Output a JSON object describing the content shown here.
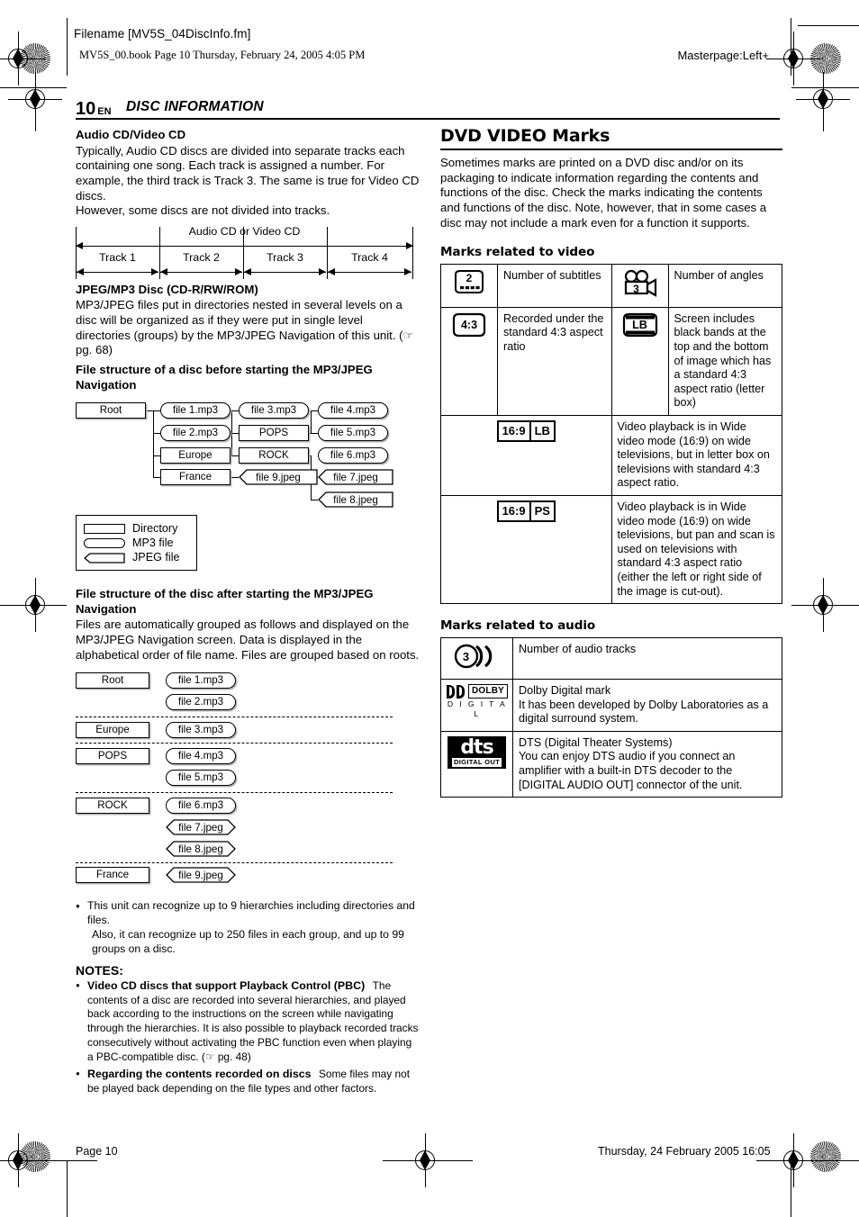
{
  "header": {
    "filename": "Filename [MV5S_04DiscInfo.fm]",
    "bookline": "MV5S_00.book  Page 10  Thursday, February 24, 2005  4:05 PM",
    "masterpage": "Masterpage:Left+"
  },
  "page": {
    "number": "10",
    "lang": "EN",
    "chapter": "DISC INFORMATION"
  },
  "left": {
    "audio_cd": {
      "heading": "Audio CD/Video CD",
      "body1": "Typically, Audio CD discs are divided into separate tracks each containing one song. Each track is assigned a number. For example, the third track is Track 3. The same is true for Video CD discs.",
      "body2": "However, some discs are not divided into tracks."
    },
    "track_figure": {
      "caption": "Audio CD or Video CD",
      "tracks": [
        "Track 1",
        "Track 2",
        "Track 3",
        "Track 4"
      ]
    },
    "jpeg_mp3": {
      "heading": "JPEG/MP3 Disc (CD-R/RW/ROM)",
      "body": "MP3/JPEG files put in directories nested in several levels on a disc will be organized as if they were put in single level directories (groups) by the MP3/JPEG Navigation of this unit. (",
      "ref": " pg. 68)"
    },
    "before_heading": "File structure of a disc before starting the MP3/JPEG Navigation",
    "tree_before": {
      "root": "Root",
      "col1": [
        "file 1.mp3",
        "file 2.mp3",
        "Europe",
        "France"
      ],
      "col2": [
        "file 3.mp3",
        "POPS",
        "ROCK",
        "file 9.jpeg"
      ],
      "col3": [
        "file 4.mp3",
        "file 5.mp3",
        "file 6.mp3",
        "file 7.jpeg",
        "file 8.jpeg"
      ]
    },
    "legend": {
      "directory": "Directory",
      "mp3": "MP3 file",
      "jpeg": "JPEG file"
    },
    "after_heading": "File structure of the disc after starting the MP3/JPEG Navigation",
    "after_body": "Files are automatically grouped as follows and displayed on the MP3/JPEG Navigation screen. Data is displayed in the alphabetical order of file name. Files are grouped based on roots.",
    "tree_after": {
      "groups": [
        {
          "dir": "Root",
          "files": [
            {
              "name": "file 1.mp3",
              "type": "mp3"
            },
            {
              "name": "file 2.mp3",
              "type": "mp3"
            }
          ]
        },
        {
          "dir": "Europe",
          "files": [
            {
              "name": "file 3.mp3",
              "type": "mp3"
            }
          ]
        },
        {
          "dir": "POPS",
          "files": [
            {
              "name": "file 4.mp3",
              "type": "mp3"
            },
            {
              "name": "file 5.mp3",
              "type": "mp3"
            }
          ]
        },
        {
          "dir": "ROCK",
          "files": [
            {
              "name": "file 6.mp3",
              "type": "mp3"
            },
            {
              "name": "file 7.jpeg",
              "type": "jpeg"
            },
            {
              "name": "file 8.jpeg",
              "type": "jpeg"
            }
          ]
        },
        {
          "dir": "France",
          "files": [
            {
              "name": "file 9.jpeg",
              "type": "jpeg"
            }
          ]
        }
      ]
    },
    "bullet1_a": "This unit can recognize up to 9 hierarchies including directories and files.",
    "bullet1_b": "Also, it can recognize up to 250 files in each group, and up to 99 groups on a disc.",
    "notes_heading": "NOTES:",
    "note1_title": "Video CD discs that support Playback Control (PBC)",
    "note1_body": "The contents of a disc are recorded into several hierarchies, and played back according to the instructions on the screen while navigating through the hierarchies. It is also possible to playback recorded tracks consecutively without activating the PBC function even when playing a PBC-compatible disc. (",
    "note1_ref": " pg. 48)",
    "note2_title": "Regarding the contents recorded on discs",
    "note2_body": "Some files may not be played back depending on the file types and other factors."
  },
  "right": {
    "title": "DVD VIDEO Marks",
    "intro": "Sometimes marks are printed on a DVD disc and/or on its packaging to indicate information regarding the contents and functions of the disc. Check the marks indicating the contents and functions of the disc. Note, however, that in some cases a disc may not include a mark even for a function it supports.",
    "video_heading": "Marks related to video",
    "video_rows": [
      {
        "icon_left": "subtitles-mark",
        "icon_left_value": "2",
        "text_left": "Number of subtitles",
        "icon_right": "angles-camera-mark",
        "icon_right_value": "3",
        "text_right": "Number of angles"
      },
      {
        "icon_left": "aspect-4-3-mark",
        "icon_left_value": "4:3",
        "text_left": "Recorded under the standard 4:3 aspect ratio",
        "icon_right": "letterbox-mark",
        "icon_right_value": "LB",
        "text_right": "Screen includes black bands at the top and the bottom of image which has a standard 4:3 aspect ratio (letter box)"
      }
    ],
    "video_wide_rows": [
      {
        "icon": "aspect-16-9-lb-mark",
        "icon_a": "16:9",
        "icon_b": "LB",
        "text": "Video playback is in Wide video mode (16:9) on wide televisions, but in letter box on televisions with standard 4:3 aspect ratio."
      },
      {
        "icon": "aspect-16-9-ps-mark",
        "icon_a": "16:9",
        "icon_b": "PS",
        "text": "Video playback is in Wide video mode (16:9) on wide televisions, but pan and scan is used on televisions with standard 4:3 aspect ratio (either the left or right side of the image is cut-out)."
      }
    ],
    "audio_heading": "Marks related to audio",
    "audio_rows": [
      {
        "icon": "audio-tracks-mark",
        "icon_value": "3",
        "text": "Number of audio tracks"
      },
      {
        "icon": "dolby-digital-mark",
        "dolby_top": "DOLBY",
        "dolby_bottom": "D I G I T A L",
        "text": "Dolby Digital mark\nIt has been developed by Dolby Laboratories as a digital surround system."
      },
      {
        "icon": "dts-digital-out-mark",
        "dts_word": "dts",
        "dts_sub": "DIGITAL OUT",
        "text": "DTS (Digital Theater Systems)\nYou can enjoy DTS audio if you connect an amplifier with a built-in DTS decoder to the [DIGITAL AUDIO OUT] connector of the unit."
      }
    ]
  },
  "footer": {
    "left": "Page 10",
    "right": "Thursday, 24 February 2005  16:05"
  }
}
